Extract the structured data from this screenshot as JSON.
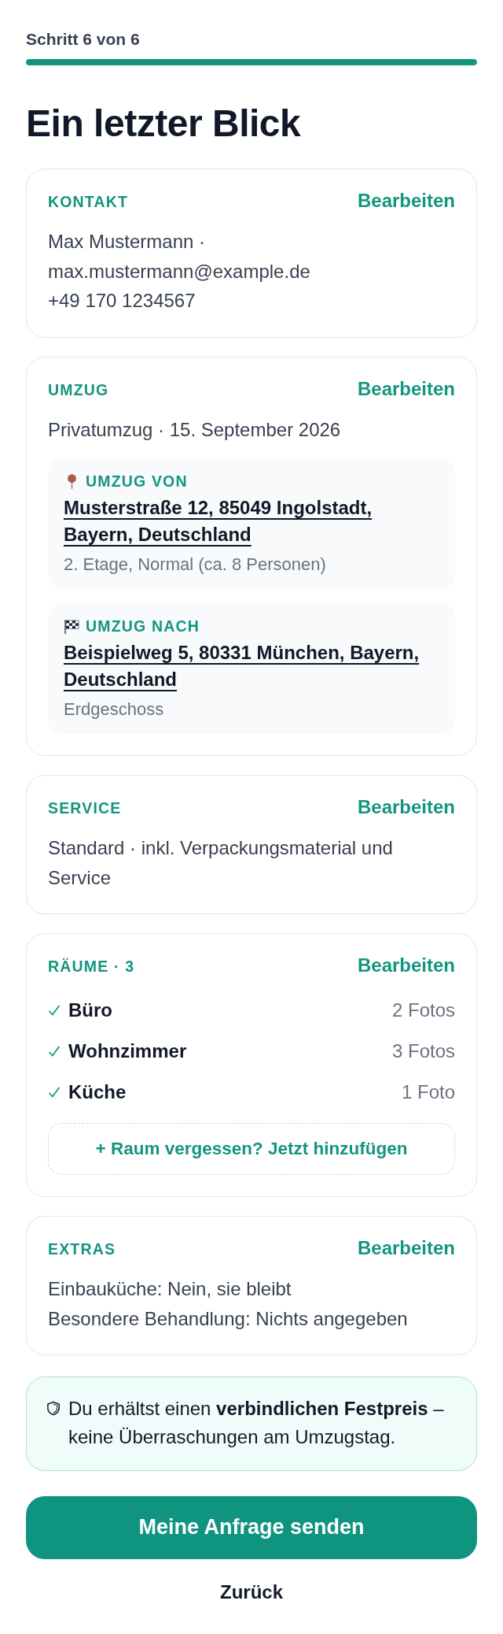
{
  "progress": {
    "label": "Schritt 6 von 6",
    "level": 1
  },
  "title": "Ein letzter Blick",
  "sections": [
    {
      "kind": "lines",
      "heading": "KONTAKT",
      "edit": "Bearbeiten",
      "lines": [
        "Max Mustermann · max.mustermann@example.de",
        "+49 170 1234567"
      ]
    },
    {
      "kind": "move",
      "heading": "UMZUG",
      "edit": "Bearbeiten",
      "lines": [
        "Privatumzug · 15. September 2026"
      ],
      "addresses": [
        {
          "kind": "from",
          "label": "UMZUG VON",
          "address": "Musterstraße 12, 85049 Ingolstadt, Bayern, Deutschland",
          "detail": "2. Etage, Normal (ca. 8 Personen)"
        },
        {
          "kind": "to",
          "label": "UMZUG NACH",
          "address": "Beispielweg 5, 80331 München, Bayern, Deutschland",
          "detail": "Erdgeschoss"
        }
      ]
    },
    {
      "kind": "lines",
      "heading": "SERVICE",
      "edit": "Bearbeiten",
      "lines": [
        "Standard · inkl. Verpackungsmaterial und Service"
      ]
    },
    {
      "kind": "rooms",
      "heading": "RÄUME · 3",
      "edit": "Bearbeiten",
      "rooms": [
        {
          "name": "Büro",
          "photos": "2 Fotos",
          "checked": true
        },
        {
          "name": "Wohnzimmer",
          "photos": "3 Fotos",
          "checked": true
        },
        {
          "name": "Küche",
          "photos": "1 Foto",
          "checked": true
        }
      ],
      "add_button": "+ Raum vergessen? Jetzt hinzufügen"
    },
    {
      "kind": "lines",
      "heading": "EXTRAS",
      "edit": "Bearbeiten",
      "lines": [
        "Einbauküche: Nein, sie bleibt",
        "Besondere Behandlung: Nichts angegeben"
      ]
    }
  ],
  "notice": {
    "text": "Du erhältst einen **verbindlichen Festpreis** – keine Überraschungen am Umzugstag."
  },
  "submit_button": "Meine Anfrage senden",
  "back_button": "Zurück"
}
